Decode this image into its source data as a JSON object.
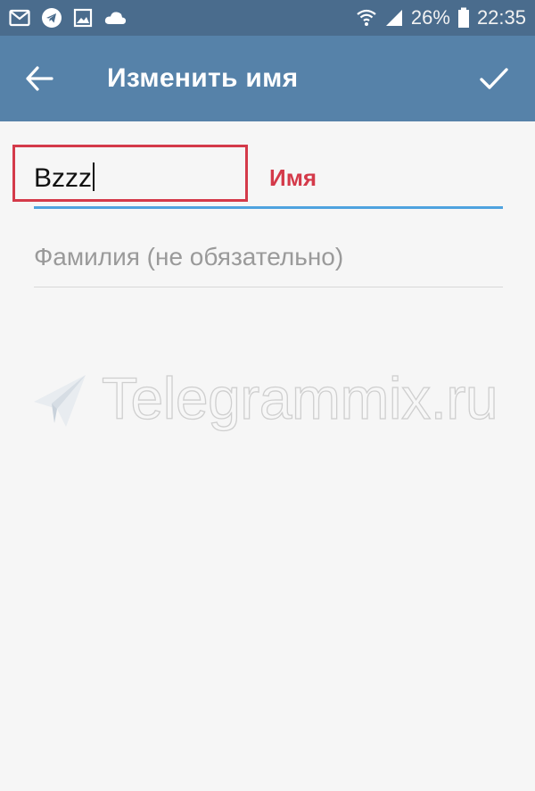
{
  "status_bar": {
    "icons": [
      "mail-icon",
      "telegram-icon",
      "image-icon",
      "cloud-icon",
      "wifi-icon",
      "signal-icon",
      "battery-icon"
    ],
    "battery": "26%",
    "time": "22:35"
  },
  "toolbar": {
    "title": "Изменить имя",
    "back_icon": "arrow-left-icon",
    "done_icon": "checkmark-icon"
  },
  "form": {
    "first_name": {
      "value": "Bzzz"
    },
    "last_name": {
      "placeholder": "Фамилия (не обязательно)",
      "value": ""
    }
  },
  "annotation": {
    "label": "Имя"
  },
  "watermark": {
    "text": "Telegrammix.ru"
  },
  "colors": {
    "status_bar": "#4a6c8d",
    "toolbar": "#5682a9",
    "accent_underline": "#4fa3df",
    "annotation_red": "#d43a4a",
    "background": "#f6f6f6"
  }
}
